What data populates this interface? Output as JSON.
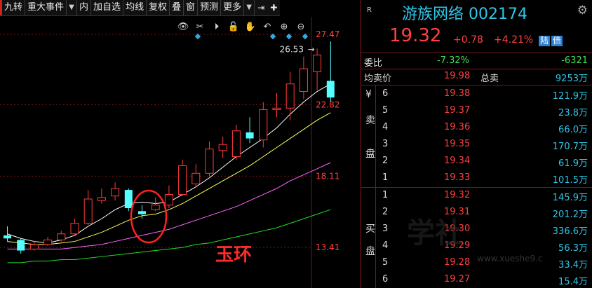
{
  "toolbar": {
    "items": [
      {
        "label": "九转",
        "icon": "",
        "arrow": false
      },
      {
        "label": "重大事件",
        "arrow": true
      },
      {
        "label": "内"
      },
      {
        "label": "加自选"
      },
      {
        "label": "均线"
      },
      {
        "label": "复权"
      },
      {
        "label": "叠"
      },
      {
        "label": "窗"
      },
      {
        "label": "预测"
      },
      {
        "label": "更多",
        "arrow": true
      }
    ],
    "end_icons": [
      "exit-icon",
      "plus-icon"
    ]
  },
  "chart": {
    "annotation": "玉环",
    "high_label": "26.53",
    "y_ticks": [
      "27.47",
      "22.82",
      "18.11",
      "13.41"
    ],
    "colors": {
      "up": "#ff3b3b",
      "down": "#54ffff",
      "ma5": "#ffffff",
      "ma10": "#ffff55",
      "ma20": "#ff66ff",
      "ma60": "#22dd22",
      "circle": "#ff2222",
      "grid": "#7a1515"
    }
  },
  "chart_data": {
    "type": "candlestick",
    "y_ticks": [
      27.47,
      22.82,
      18.11,
      13.41
    ],
    "high_marker": 26.53,
    "candles": [
      {
        "o": 14.2,
        "c": 14.0,
        "h": 14.8,
        "l": 13.8
      },
      {
        "o": 13.9,
        "c": 13.2,
        "h": 14.0,
        "l": 13.0
      },
      {
        "o": 13.3,
        "c": 13.6,
        "h": 13.8,
        "l": 13.2
      },
      {
        "o": 13.6,
        "c": 13.9,
        "h": 14.1,
        "l": 13.5
      },
      {
        "o": 13.9,
        "c": 14.3,
        "h": 14.5,
        "l": 13.8
      },
      {
        "o": 14.3,
        "c": 15.0,
        "h": 15.3,
        "l": 14.2
      },
      {
        "o": 15.0,
        "c": 16.6,
        "h": 17.2,
        "l": 14.9
      },
      {
        "o": 16.5,
        "c": 16.7,
        "h": 17.3,
        "l": 16.3
      },
      {
        "o": 16.8,
        "c": 17.3,
        "h": 17.7,
        "l": 16.5
      },
      {
        "o": 17.2,
        "c": 16.0,
        "h": 17.3,
        "l": 15.8
      },
      {
        "o": 15.8,
        "c": 15.6,
        "h": 16.2,
        "l": 15.3
      },
      {
        "o": 15.9,
        "c": 16.2,
        "h": 16.7,
        "l": 15.8
      },
      {
        "o": 16.2,
        "c": 16.9,
        "h": 17.5,
        "l": 16.0
      },
      {
        "o": 16.9,
        "c": 18.8,
        "h": 19.2,
        "l": 16.8
      },
      {
        "o": 17.6,
        "c": 18.3,
        "h": 18.9,
        "l": 17.4
      },
      {
        "o": 18.3,
        "c": 19.9,
        "h": 20.4,
        "l": 18.1
      },
      {
        "o": 19.8,
        "c": 20.2,
        "h": 20.7,
        "l": 19.3
      },
      {
        "o": 19.4,
        "c": 21.1,
        "h": 21.5,
        "l": 19.2
      },
      {
        "o": 21.0,
        "c": 20.6,
        "h": 22.0,
        "l": 20.3
      },
      {
        "o": 20.5,
        "c": 22.5,
        "h": 23.0,
        "l": 20.0
      },
      {
        "o": 22.5,
        "c": 22.6,
        "h": 23.6,
        "l": 22.0
      },
      {
        "o": 22.6,
        "c": 24.2,
        "h": 25.0,
        "l": 21.8
      },
      {
        "o": 23.7,
        "c": 25.2,
        "h": 26.0,
        "l": 23.2
      },
      {
        "o": 25.0,
        "c": 26.1,
        "h": 26.53,
        "l": 23.8
      },
      {
        "o": 24.4,
        "c": 23.3,
        "h": 27.0,
        "l": 23.0
      }
    ],
    "ma5": [
      14.3,
      14.0,
      13.8,
      13.7,
      13.9,
      14.2,
      14.8,
      15.3,
      15.9,
      16.3,
      16.4,
      16.3,
      16.4,
      16.9,
      17.4,
      18.0,
      18.7,
      19.4,
      20.0,
      20.6,
      21.3,
      22.2,
      23.0,
      23.7,
      24.2
    ],
    "ma10": [
      13.8,
      13.7,
      13.6,
      13.6,
      13.7,
      13.8,
      14.1,
      14.4,
      14.8,
      15.2,
      15.5,
      15.6,
      15.9,
      16.3,
      16.8,
      17.3,
      17.8,
      18.3,
      18.8,
      19.4,
      20.0,
      20.6,
      21.2,
      21.8,
      22.3
    ],
    "ma20": [
      13.3,
      13.3,
      13.3,
      13.3,
      13.3,
      13.4,
      13.5,
      13.6,
      13.8,
      14.0,
      14.2,
      14.4,
      14.6,
      14.9,
      15.2,
      15.5,
      15.8,
      16.1,
      16.5,
      16.9,
      17.3,
      17.8,
      18.2,
      18.6,
      19.0
    ],
    "ma60": [
      12.4,
      12.4,
      12.5,
      12.5,
      12.6,
      12.6,
      12.7,
      12.8,
      12.9,
      13.0,
      13.1,
      13.2,
      13.3,
      13.4,
      13.6,
      13.7,
      13.9,
      14.1,
      14.3,
      14.5,
      14.7,
      15.0,
      15.3,
      15.6,
      15.9
    ]
  },
  "panel": {
    "r_label": "R",
    "stock_name": "游族网络 002174",
    "price": "19.32",
    "change": "+0.78",
    "change_pct": "+4.21%",
    "badges": [
      "陆",
      "债"
    ],
    "weibi": {
      "label": "委比",
      "pct": "-7.32%",
      "diff": "-6321"
    },
    "avg": {
      "label": "均卖价",
      "value": "19.98",
      "total_label": "总卖",
      "total": "9253万"
    },
    "sell_side": [
      "¥",
      "卖",
      "盘"
    ],
    "buy_side": [
      "买",
      "盘"
    ],
    "sell": [
      {
        "level": "6",
        "price": "19.38",
        "vol": "121.9万"
      },
      {
        "level": "5",
        "price": "19.37",
        "vol": "23.8万"
      },
      {
        "level": "4",
        "price": "19.36",
        "vol": "66.0万"
      },
      {
        "level": "3",
        "price": "19.35",
        "vol": "170.7万"
      },
      {
        "level": "2",
        "price": "19.34",
        "vol": "61.9万"
      },
      {
        "level": "1",
        "price": "19.33",
        "vol": "101.5万"
      }
    ],
    "buy": [
      {
        "level": "1",
        "price": "19.32",
        "vol": "145.9万"
      },
      {
        "level": "2",
        "price": "19.31",
        "vol": "201.2万"
      },
      {
        "level": "3",
        "price": "19.30",
        "vol": "336.6万"
      },
      {
        "level": "4",
        "price": "19.29",
        "vol": "56.3万"
      },
      {
        "level": "5",
        "price": "19.28",
        "vol": "33.4万"
      },
      {
        "level": "6",
        "price": "19.27",
        "vol": "15.4万"
      }
    ],
    "watermark": "学社",
    "watermark_url": "www.xueshe9.c"
  }
}
